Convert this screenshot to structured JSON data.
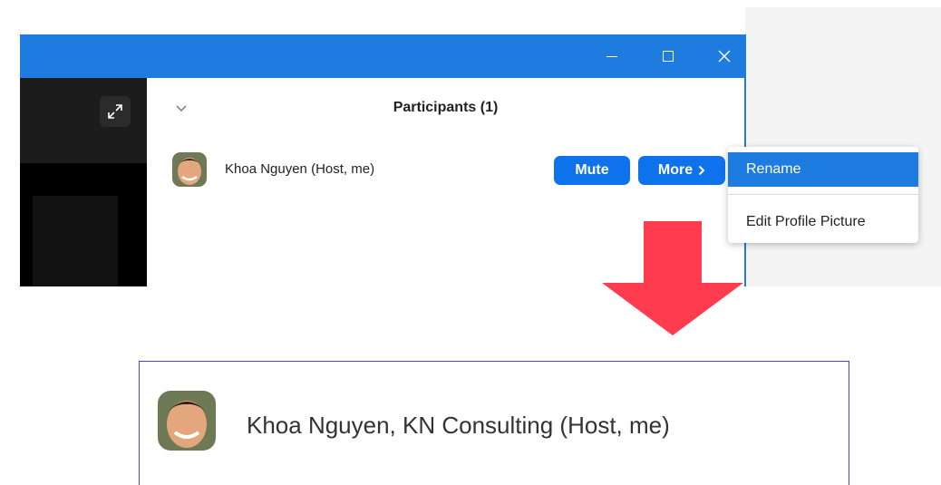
{
  "window": {
    "controls": [
      "minimize-icon",
      "maximize-icon",
      "close-icon"
    ],
    "accent_color": "#1e7be0"
  },
  "participants_panel": {
    "title": "Participants (1)",
    "participant": {
      "name": "Khoa Nguyen (Host, me)",
      "mute_label": "Mute",
      "more_label": "More",
      "more_icon": "chevron-right-icon"
    }
  },
  "more_menu": {
    "items": [
      {
        "label": "Rename"
      },
      {
        "label": "Edit Profile Picture"
      }
    ],
    "highlight_color": "#1e7be0"
  },
  "arrow": {
    "icon": "down-arrow-icon",
    "color": "#ff3b4f"
  },
  "result": {
    "name": "Khoa Nguyen, KN Consulting (Host, me)"
  },
  "colors": {
    "button_blue": "#0e72ed",
    "result_border": "#4a4aa8"
  }
}
